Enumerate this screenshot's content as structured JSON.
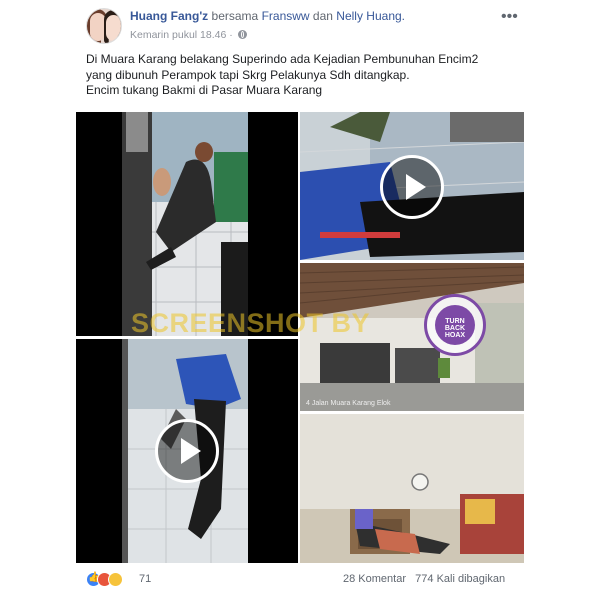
{
  "post": {
    "author": "Huang Fang'z",
    "with_word": "bersama",
    "tagged_1": "Fransww",
    "and_word": "dan",
    "tagged_2": "Nelly Huang.",
    "timestamp": "Kemarin pukul 18.46",
    "more_label": "•••",
    "text_lines": [
      "Di Muara Karang belakang Superindo ada Kejadian Pembunuhan Encim2",
      "yang dibunuh Perampok tapi Skrg Pelakunya Sdh ditangkap.",
      "Encim tukang Bakmi di Pasar Muara Karang"
    ]
  },
  "media": {
    "watermark": "SCREENSHOT BY",
    "seal_lines": [
      "TURN",
      "BACK",
      "HOAX"
    ],
    "seal_ring_text": "MASYARAKAT ANTI FITNAH INDONESIA · MAFINDO",
    "street_caption": "4 Jalan Muara Karang Elok"
  },
  "footer": {
    "reaction_count": "71",
    "comments": "28 Komentar",
    "shares": "774 Kali dibagikan"
  },
  "icons": {
    "reactions": [
      "like-icon",
      "angry-icon",
      "wow-icon"
    ],
    "privacy": "globe-icon"
  },
  "colors": {
    "link": "#385898",
    "meta": "#90949c",
    "watermark": "#ecc428",
    "seal": "#7d4aa6"
  }
}
